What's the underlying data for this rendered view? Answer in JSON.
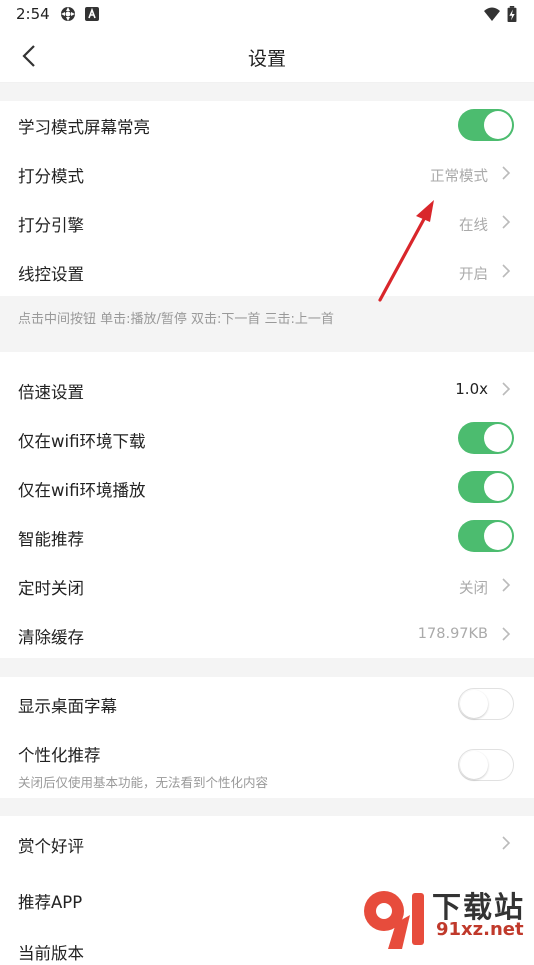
{
  "status_bar": {
    "time": "2:54"
  },
  "nav": {
    "title": "设置"
  },
  "section1": {
    "items": [
      {
        "label": "学习模式屏幕常亮",
        "toggle": true
      },
      {
        "label": "打分模式",
        "value": "正常模式"
      },
      {
        "label": "打分引擎",
        "value": "在线"
      },
      {
        "label": "线控设置",
        "value": "开启"
      }
    ],
    "hint": "点击中间按钮 单击:播放/暂停 双击:下一首 三击:上一首"
  },
  "section2": {
    "items": [
      {
        "label": "倍速设置",
        "value": "1.0x"
      },
      {
        "label": "仅在wifi环境下载",
        "toggle": true
      },
      {
        "label": "仅在wifi环境播放",
        "toggle": true
      },
      {
        "label": "智能推荐",
        "toggle": true
      },
      {
        "label": "定时关闭",
        "value": "关闭"
      },
      {
        "label": "清除缓存",
        "value": "178.97KB"
      }
    ]
  },
  "section3": {
    "items": [
      {
        "label": "显示桌面字幕",
        "toggle": false
      },
      {
        "label": "个性化推荐",
        "sublabel": "关闭后仅使用基本功能，无法看到个性化内容",
        "toggle": false
      }
    ]
  },
  "section4": {
    "items": [
      {
        "label": "赏个好评"
      },
      {
        "label": "推荐APP"
      },
      {
        "label": "当前版本"
      }
    ]
  },
  "watermark": {
    "title": "下载站",
    "url": "91xz.net"
  },
  "colors": {
    "toggle_on": "#4cbc6f",
    "annotation_arrow": "#d9262b",
    "section_gap": "#f4f4f4"
  }
}
